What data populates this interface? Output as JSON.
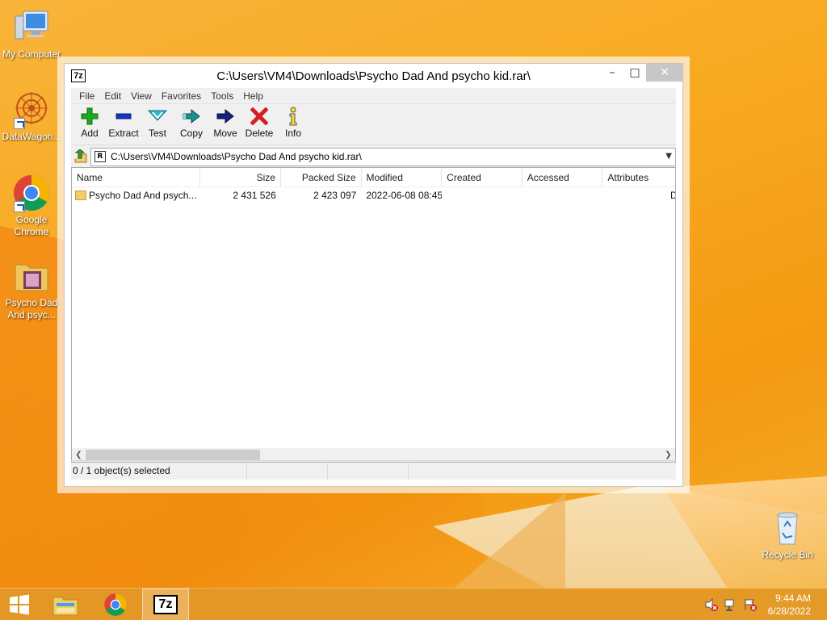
{
  "desktop": {
    "icons": [
      {
        "label": "My Computer"
      },
      {
        "label": "DataWagon..."
      },
      {
        "label": "Google Chrome"
      },
      {
        "label": "Psycho Dad And psyc..."
      },
      {
        "label": "Recycle Bin"
      }
    ]
  },
  "window": {
    "app_icon": "7z",
    "title": "C:\\Users\\VM4\\Downloads\\Psycho Dad And psycho kid.rar\\",
    "minimize": "–",
    "maximize": "□",
    "close": "✕"
  },
  "menu": [
    "File",
    "Edit",
    "View",
    "Favorites",
    "Tools",
    "Help"
  ],
  "toolbar": [
    {
      "label": "Add",
      "icon": "add-icon",
      "color": "#1fa81f"
    },
    {
      "label": "Extract",
      "icon": "extract-icon",
      "color": "#1737c2"
    },
    {
      "label": "Test",
      "icon": "test-icon",
      "color": "#2bb5c8"
    },
    {
      "label": "Copy",
      "icon": "copy-icon",
      "color": "#1d8f8f"
    },
    {
      "label": "Move",
      "icon": "move-icon",
      "color": "#16207f"
    },
    {
      "label": "Delete",
      "icon": "delete-icon",
      "color": "#d42020"
    },
    {
      "label": "Info",
      "icon": "info-icon",
      "color": "#c8b400"
    }
  ],
  "address": {
    "icon": "R",
    "path": "C:\\Users\\VM4\\Downloads\\Psycho Dad And psycho kid.rar\\"
  },
  "columns": [
    "Name",
    "Size",
    "Packed Size",
    "Modified",
    "Created",
    "Accessed",
    "Attributes"
  ],
  "rows": [
    {
      "name": "Psycho Dad And psych...",
      "size": "2 431 526",
      "packed": "2 423 097",
      "modified": "2022-06-08 08:45",
      "created": "",
      "accessed": "",
      "attributes": "D"
    }
  ],
  "status": {
    "selected": "0 / 1 object(s) selected"
  },
  "taskbar": {
    "time": "9:44 AM",
    "date": "6/28/2022",
    "active_app": "7z"
  }
}
